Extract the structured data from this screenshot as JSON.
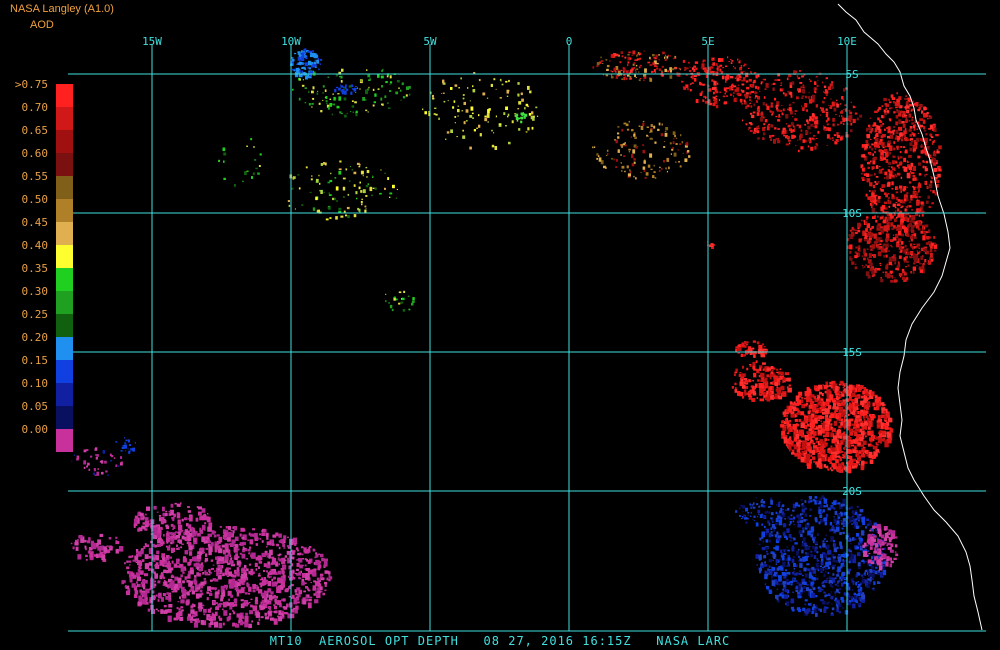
{
  "header": {
    "title": "NASA Langley (A1.0)",
    "unit": "AOD"
  },
  "legend": {
    "labels": [
      ">0.75",
      "0.70",
      "0.65",
      "0.60",
      "0.55",
      "0.50",
      "0.45",
      "0.40",
      "0.35",
      "0.30",
      "0.25",
      "0.20",
      "0.15",
      "0.10",
      "0.05",
      "0.00"
    ],
    "colors": [
      "#ff2020",
      "#d01818",
      "#a01010",
      "#7a1010",
      "#806018",
      "#b08028",
      "#e0b050",
      "#ffff30",
      "#20d020",
      "#20a020",
      "#106010",
      "#2090f0",
      "#1040e0",
      "#1020a0",
      "#0a1060",
      "#c8309c"
    ]
  },
  "grid": {
    "longitudes": [
      "15W",
      "10W",
      "5W",
      "0",
      "5E",
      "10E"
    ],
    "latitudes": [
      "5S",
      "10S",
      "15S",
      "20S"
    ],
    "color": "#40e0e0"
  },
  "footer": "MT10  AEROSOL OPT DEPTH   08 27, 2016 16:15Z   NASA LARC"
}
